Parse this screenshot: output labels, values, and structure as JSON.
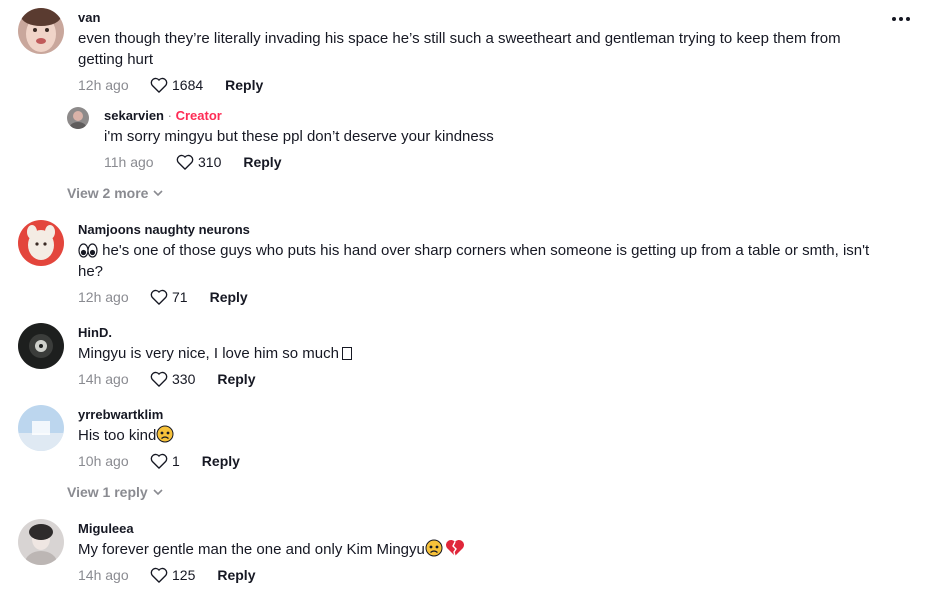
{
  "comments": [
    {
      "username": "van",
      "text": "even though they’re literally invading his space he’s still such a sweetheart and gentleman trying to keep them from getting hurt",
      "time": "12h ago",
      "likes": "1684",
      "reply_label": "Reply"
    },
    {
      "username": "sekarvien",
      "badge_separator": "·",
      "badge": "Creator",
      "text": "i'm sorry mingyu but these ppl don’t deserve your kindness",
      "time": "11h ago",
      "likes": "310",
      "reply_label": "Reply"
    },
    {
      "username": "Namjoons naughty neurons",
      "text_prefix_emoji": "eyes-emoji",
      "text": " he's one of those guys who puts his hand over sharp corners when someone is getting up from a table or smth, isn't he?",
      "time": "12h ago",
      "likes": "71",
      "reply_label": "Reply"
    },
    {
      "username": "HinD.",
      "text": "Mingyu is very nice, I love him so much",
      "time": "14h ago",
      "likes": "330",
      "reply_label": "Reply"
    },
    {
      "username": "yrrebwartklim",
      "text": "His too kind",
      "time": "10h ago",
      "likes": "1",
      "reply_label": "Reply"
    },
    {
      "username": "Miguleea",
      "text": "My forever gentle man the one and only Kim Mingyu",
      "time": "14h ago",
      "likes": "125",
      "reply_label": "Reply"
    }
  ],
  "view_more": [
    {
      "label": "View 2 more"
    },
    {
      "label": "View 1 reply"
    }
  ],
  "icons": {
    "more": "more-horizontal-icon",
    "like": "heart-outline-icon",
    "expand": "chevron-down-icon"
  },
  "colors": {
    "creator_badge": "#fe2c55",
    "secondary_text": "#8a8b91",
    "primary_text": "#161823"
  }
}
